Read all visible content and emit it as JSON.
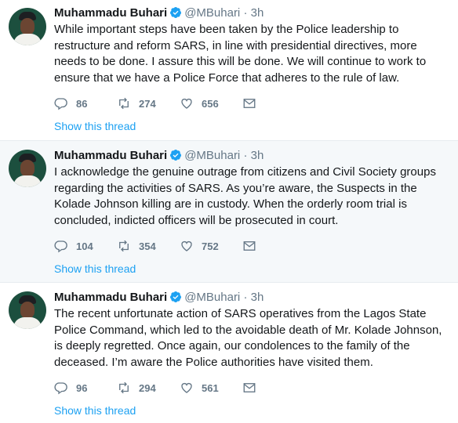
{
  "colors": {
    "link": "#1da1f2",
    "muted": "#657786",
    "text": "#14171a",
    "verified": "#1da1f2",
    "highlight_bg": "#f5f8fa"
  },
  "tweets": [
    {
      "name": "Muhammadu Buhari",
      "handle": "@MBuhari",
      "separator": "·",
      "time": "3h",
      "text": "While important steps have been taken by the Police leadership to restructure and reform SARS, in line with presidential directives, more needs to be done. I assure this will be done. We will continue to work to ensure that we have a Police Force that adheres to the rule of law.",
      "replies": "86",
      "retweets": "274",
      "likes": "656",
      "show_thread": "Show this thread"
    },
    {
      "name": "Muhammadu Buhari",
      "handle": "@MBuhari",
      "separator": "·",
      "time": "3h",
      "text": "I acknowledge the genuine outrage from citizens and Civil Society groups regarding the activities of SARS. As you’re aware, the Suspects in the Kolade Johnson killing are in custody. When the orderly room trial is concluded, indicted officers will be prosecuted in court.",
      "replies": "104",
      "retweets": "354",
      "likes": "752",
      "show_thread": "Show this thread"
    },
    {
      "name": "Muhammadu Buhari",
      "handle": "@MBuhari",
      "separator": "·",
      "time": "3h",
      "text": "The recent unfortunate action of SARS operatives from the Lagos State Police Command, which led to the avoidable death of Mr. Kolade Johnson, is deeply regretted. Once again, our condolences to the family of the deceased. I’m aware the Police authorities have visited them.",
      "replies": "96",
      "retweets": "294",
      "likes": "561",
      "show_thread": "Show this thread"
    }
  ],
  "icons": {
    "reply": "reply-icon",
    "retweet": "retweet-icon",
    "like": "heart-icon",
    "dm": "envelope-icon",
    "verified": "verified-badge-icon"
  }
}
